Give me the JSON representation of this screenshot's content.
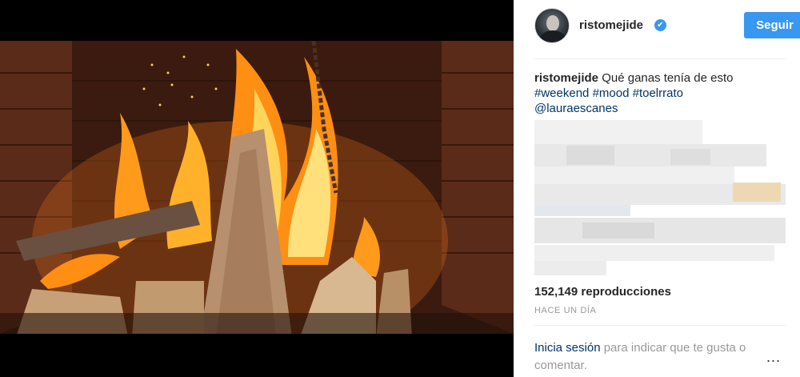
{
  "post": {
    "username": "ristomejide",
    "verified_mark": "✔",
    "follow_label": "Seguir",
    "caption": {
      "user": "ristomejide",
      "text": "Qué ganas tenía de esto",
      "tags": [
        "#weekend",
        "#mood",
        "#toelrrato"
      ],
      "mention": "@lauraescanes"
    },
    "views": "152,149 reproducciones",
    "timestamp": "HACE UN DÍA",
    "login": {
      "link": "Inicia sesión",
      "rest": "para indicar que te gusta o comentar."
    },
    "more_label": "..."
  },
  "icons": {
    "verified": "verified-badge-icon",
    "more": "more-options-icon"
  },
  "colors": {
    "accent": "#3897f0",
    "link": "#003569",
    "muted": "#999999"
  }
}
